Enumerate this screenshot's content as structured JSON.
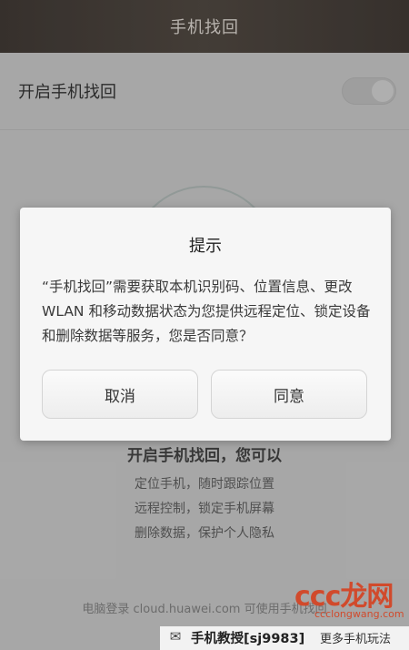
{
  "header": {
    "title": "手机找回"
  },
  "settings": {
    "toggle_label": "开启手机找回",
    "toggle_on": false
  },
  "features": {
    "heading": "开启手机找回，您可以",
    "lines": [
      "定位手机，随时跟踪位置",
      "远程控制，锁定手机屏幕",
      "删除数据，保护个人隐私"
    ]
  },
  "footer_note": "电脑登录 cloud.huawei.com 可使用手机找回",
  "dialog": {
    "title": "提示",
    "message": "“手机找回”需要获取本机识别码、位置信息、更改WLAN 和移动数据状态为您提供远程定位、锁定设备和删除数据等服务，您是否同意？",
    "cancel_label": "取消",
    "agree_label": "同意"
  },
  "watermark": {
    "account": "手机教授[sj9983]",
    "tagline": "更多手机玩法",
    "logo_text": "ccc龙网",
    "logo_sub": "ccclongwang.com"
  },
  "colors": {
    "header_bg": "#3f3832",
    "dialog_bg": "#f6f6f6",
    "logo_red": "#d14a2c"
  }
}
